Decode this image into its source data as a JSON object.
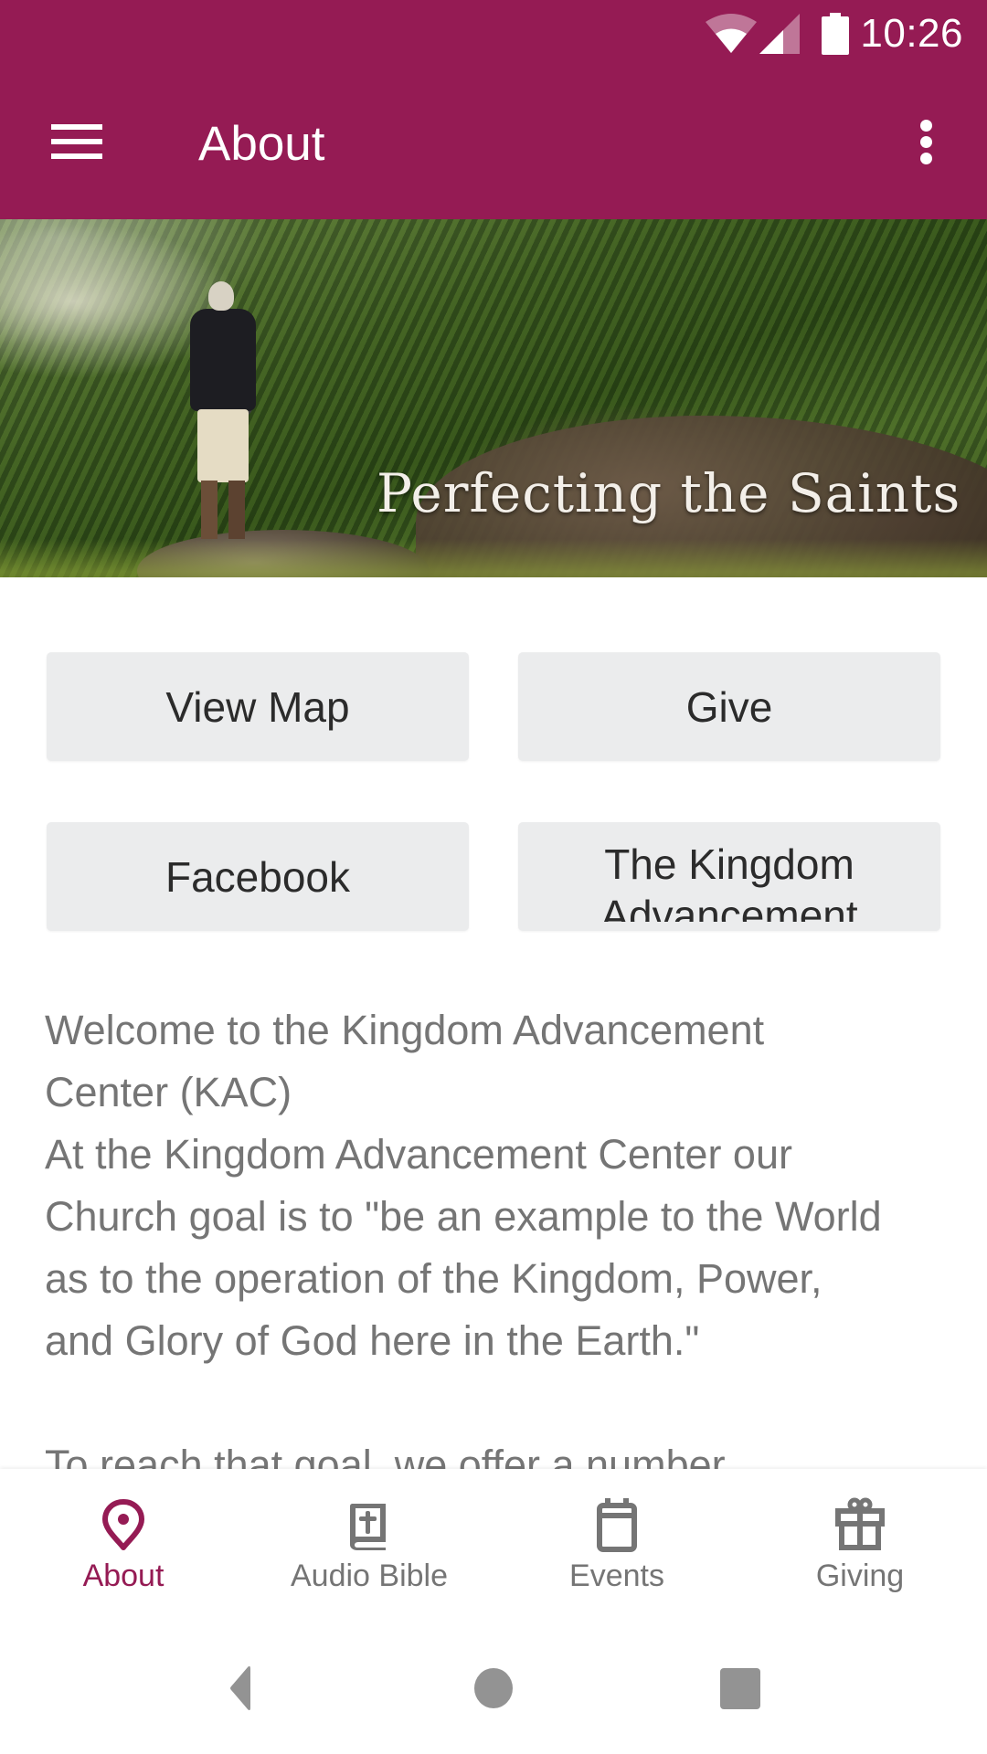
{
  "status_bar": {
    "time": "10:26",
    "icons": [
      "wifi-icon",
      "cell-signal-icon",
      "battery-icon"
    ]
  },
  "toolbar": {
    "title": "About",
    "menu_icon": "hamburger-menu-icon",
    "overflow_icon": "more-vertical-icon",
    "color": "#951b54"
  },
  "hero": {
    "banner_text": "Perfecting the Saints"
  },
  "buttons": [
    {
      "label": "View Map"
    },
    {
      "label": "Give"
    },
    {
      "label": "Facebook"
    },
    {
      "label": "The Kingdom Advancement"
    }
  ],
  "content": {
    "lines": [
      "Welcome to the Kingdom Advancement",
      "Center (KAC)",
      "At the Kingdom Advancement Center our",
      "Church goal is to \"be an example to the World",
      "as to the operation of the Kingdom, Power,",
      "and Glory of God here in the Earth.\"",
      "",
      "To reach that goal, we offer a number"
    ],
    "text_color": "#757575"
  },
  "bottom_nav": {
    "active_color": "#951b54",
    "inactive_color": "#757575",
    "tabs": [
      {
        "label": "About",
        "icon": "location-pin-icon",
        "active": true
      },
      {
        "label": "Audio Bible",
        "icon": "bible-icon",
        "active": false
      },
      {
        "label": "Events",
        "icon": "calendar-icon",
        "active": false
      },
      {
        "label": "Giving",
        "icon": "gift-icon",
        "active": false
      }
    ]
  },
  "system_nav": {
    "buttons": [
      "back-icon",
      "home-icon",
      "recents-icon"
    ]
  }
}
